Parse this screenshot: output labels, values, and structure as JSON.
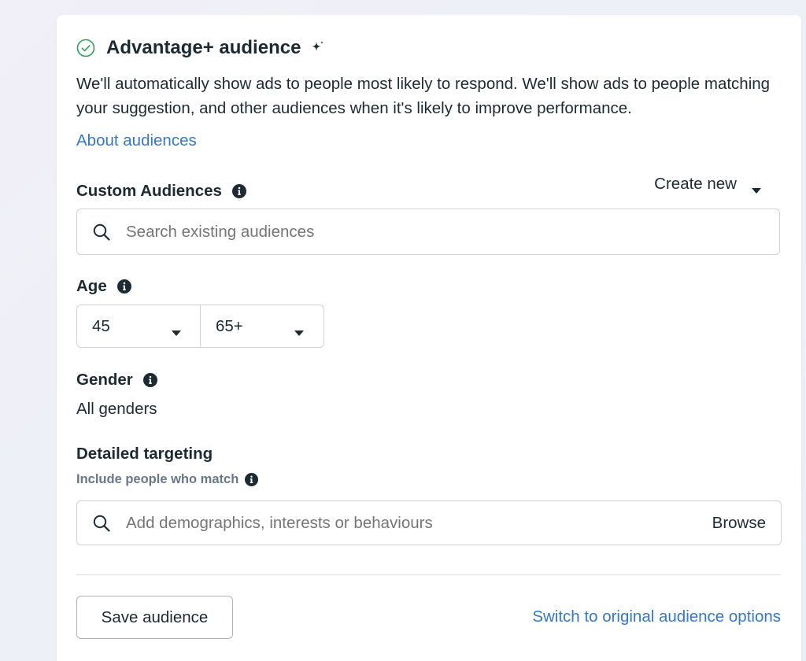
{
  "advantage": {
    "title": "Advantage+ audience",
    "description": "We'll automatically show ads to people most likely to respond. We'll show ads to people matching your suggestion, and other audiences when it's likely to improve performance.",
    "about_link": "About audiences"
  },
  "custom_audiences": {
    "label": "Custom Audiences",
    "create_new": "Create new",
    "search_placeholder": "Search existing audiences"
  },
  "age": {
    "label": "Age",
    "min": "45",
    "max": "65+"
  },
  "gender": {
    "label": "Gender",
    "value": "All genders"
  },
  "detailed_targeting": {
    "label": "Detailed targeting",
    "sublabel": "Include people who match",
    "search_placeholder": "Add demographics, interests or behaviours",
    "browse": "Browse"
  },
  "footer": {
    "save_button": "Save audience",
    "switch_link": "Switch to original audience options"
  },
  "colors": {
    "link": "#3578c6",
    "check": "#2e9e5b",
    "text": "#1c2b33"
  },
  "icons": [
    "check-circle-icon",
    "sparkle-icon",
    "info-icon",
    "caret-down-icon",
    "search-icon"
  ]
}
